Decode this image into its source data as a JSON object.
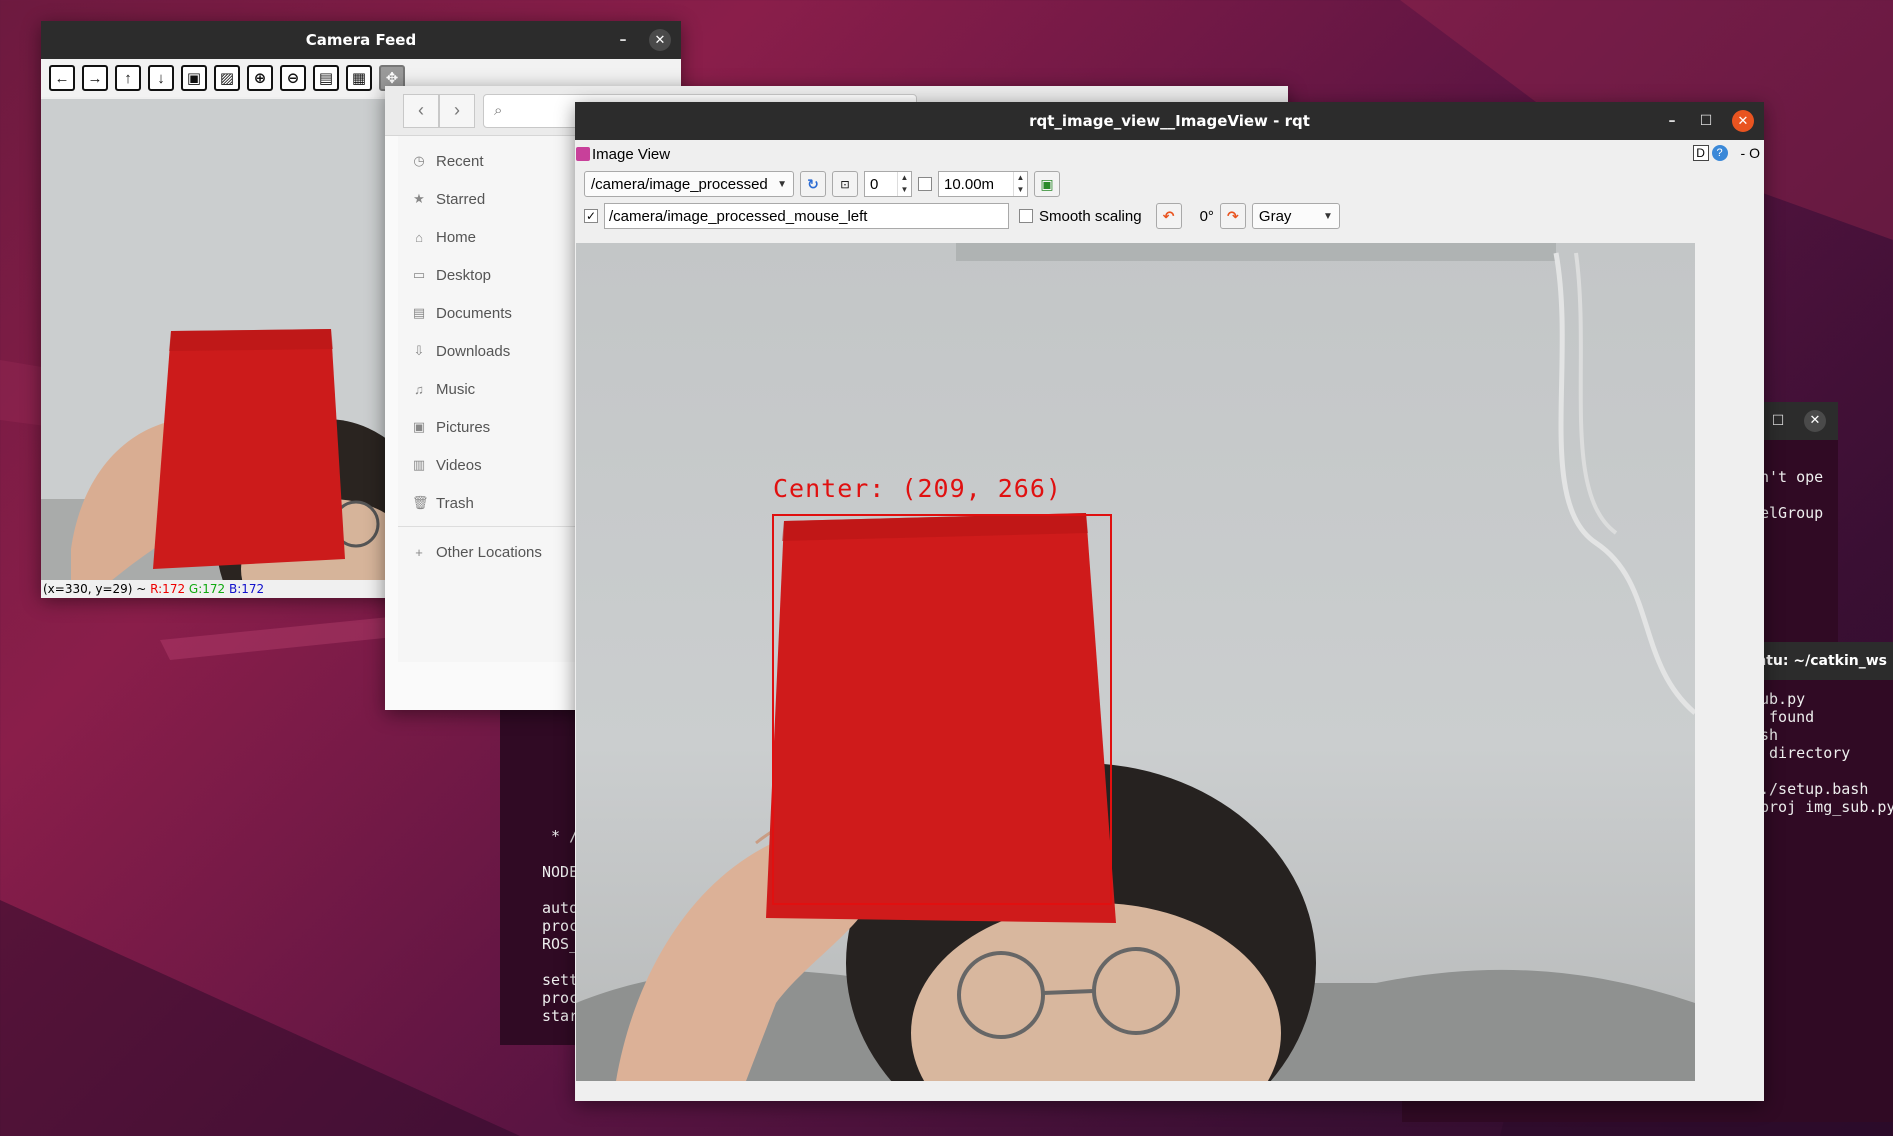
{
  "camera_window": {
    "title": "Camera Feed",
    "toolbar_icons": [
      "arrow-left-icon",
      "arrow-right-icon",
      "arrow-up-icon",
      "arrow-down-icon",
      "image-icon",
      "image-settings-icon",
      "zoom-in-icon",
      "zoom-out-icon",
      "save-icon",
      "properties-icon",
      "pan-icon"
    ],
    "status": {
      "coords": "(x=330, y=29) ~ ",
      "r": "R:172",
      "g": "G:172",
      "b": "B:172"
    }
  },
  "files_window": {
    "sidebar": [
      {
        "label": "Recent",
        "icon": "clock-icon"
      },
      {
        "label": "Starred",
        "icon": "star-icon"
      },
      {
        "label": "Home",
        "icon": "home-icon"
      },
      {
        "label": "Desktop",
        "icon": "desktop-icon"
      },
      {
        "label": "Documents",
        "icon": "document-icon"
      },
      {
        "label": "Downloads",
        "icon": "download-icon"
      },
      {
        "label": "Music",
        "icon": "music-icon"
      },
      {
        "label": "Pictures",
        "icon": "picture-icon"
      },
      {
        "label": "Videos",
        "icon": "video-icon"
      },
      {
        "label": "Trash",
        "icon": "trash-icon"
      }
    ],
    "other_locations": "Other Locations"
  },
  "rqt_window": {
    "title": "rqt_image_view__ImageView - rqt",
    "plugin_title": "Image View",
    "help_d": "D",
    "help_q": "?",
    "right_extra": "- O",
    "topic": "/camera/image_processed",
    "spin_value": "0",
    "time_value": "10.00m",
    "mouse_enabled": true,
    "mouse_topic": "/camera/image_processed_mouse_left",
    "smooth_scaling_label": "Smooth scaling",
    "rotation": "0°",
    "color_scheme": "Gray",
    "overlay_text": "Center: (209, 266)"
  },
  "terminal_right": {
    "title": "ntu: ~/catkin_ws",
    "lines_top": [
      "n't ope",
      "",
      "elGroup"
    ],
    "lines": [
      "ub.py",
      " found",
      "sh",
      " directory",
      "",
      "./setup.bash",
      "proj img_sub.py"
    ]
  },
  "terminal_bottom": {
    "lines": [
      " * /",
      "",
      "NODE",
      "",
      "auto",
      "proc",
      "ROS_",
      "",
      "sett",
      "proc",
      "star"
    ]
  },
  "colors": {
    "accent": "#e95420",
    "titlebar": "#2c2c2c",
    "terminal_bg": "#300a24",
    "bbox": "#e01010"
  }
}
